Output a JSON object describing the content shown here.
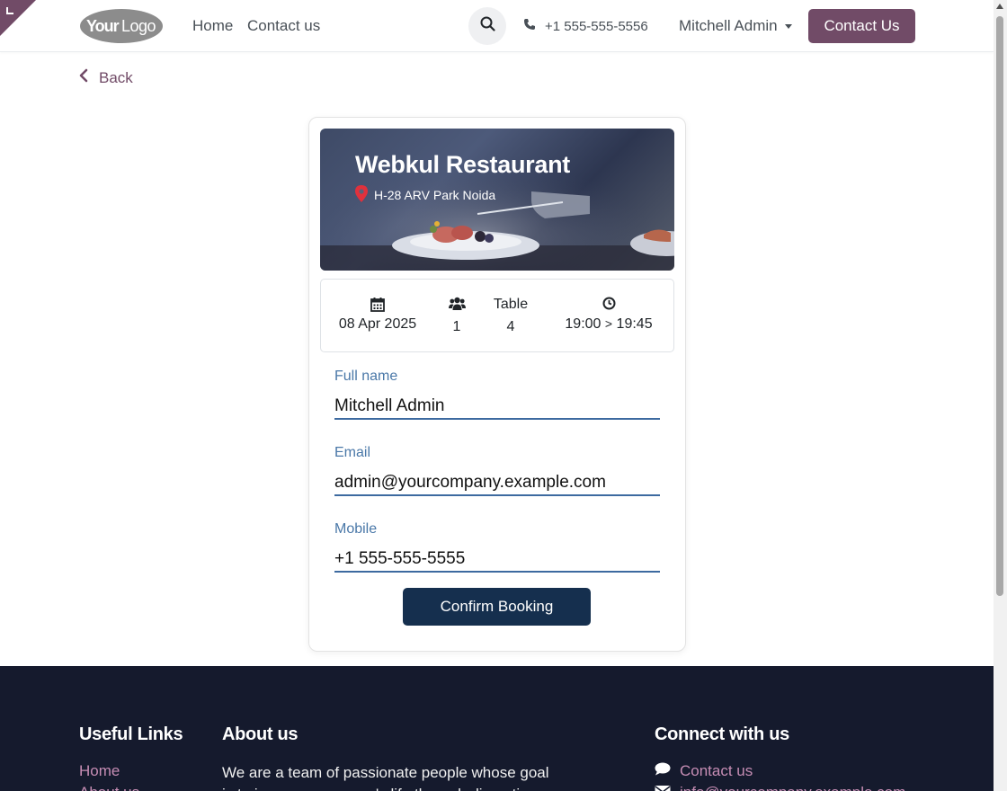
{
  "header": {
    "nav": [
      {
        "label": "Home"
      },
      {
        "label": "Contact us"
      }
    ],
    "phone": "+1 555-555-5556",
    "user": "Mitchell Admin",
    "contact_button": "Contact Us"
  },
  "back_label": "Back",
  "restaurant": {
    "name": "Webkul Restaurant",
    "address": "H-28 ARV Park Noida"
  },
  "booking": {
    "date": "08 Apr 2025",
    "guests": "1",
    "table_label": "Table",
    "table_number": "4",
    "time_start": "19:00",
    "time_separator": ">",
    "time_end": "19:45"
  },
  "form": {
    "full_name": {
      "label": "Full name",
      "value": "Mitchell Admin"
    },
    "email": {
      "label": "Email",
      "value": "admin@yourcompany.example.com"
    },
    "mobile": {
      "label": "Mobile",
      "value": "+1 555-555-5555"
    },
    "submit": "Confirm Booking"
  },
  "footer": {
    "useful_links": {
      "title": "Useful Links",
      "items": [
        "Home",
        "About us"
      ]
    },
    "about": {
      "title": "About us",
      "text": "We are a team of passionate people whose goal is to improve everyone's life through disruptive"
    },
    "connect": {
      "title": "Connect with us",
      "items": [
        "Contact us",
        "info@yourcompany.example.com"
      ]
    }
  },
  "colors": {
    "brand": "#714b67",
    "primary": "#152f4e",
    "footer_bg": "#151a2d",
    "field_label": "#4a78a8"
  },
  "icons": {
    "search": "search-icon",
    "phone": "phone-icon",
    "back": "chevron-left-icon",
    "location": "map-marker-icon",
    "calendar": "calendar-icon",
    "guests": "users-icon",
    "time": "clock-icon",
    "comment": "comment-icon",
    "envelope": "envelope-icon"
  }
}
